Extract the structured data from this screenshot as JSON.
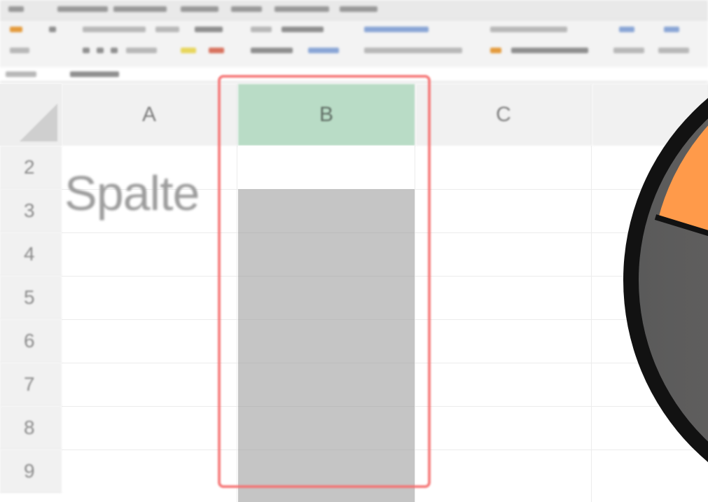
{
  "spreadsheet": {
    "columns": [
      "A",
      "B",
      "C"
    ],
    "selected_column": "B",
    "rows": [
      "2",
      "3",
      "4",
      "5",
      "6",
      "7",
      "8",
      "9"
    ],
    "cell_a2_text": "Spalte"
  },
  "colors": {
    "selected_header": "#b9dcc6",
    "selection_fill": "#c5c5c5",
    "highlight_frame": "#f57070",
    "pie_orange": "#ff9a4a",
    "pie_gray": "#6b6b6b",
    "pie_outline": "#111111"
  },
  "icons": {
    "corner": "select-all-corner-icon",
    "overlay_graphic": "pie-segment-graphic"
  }
}
